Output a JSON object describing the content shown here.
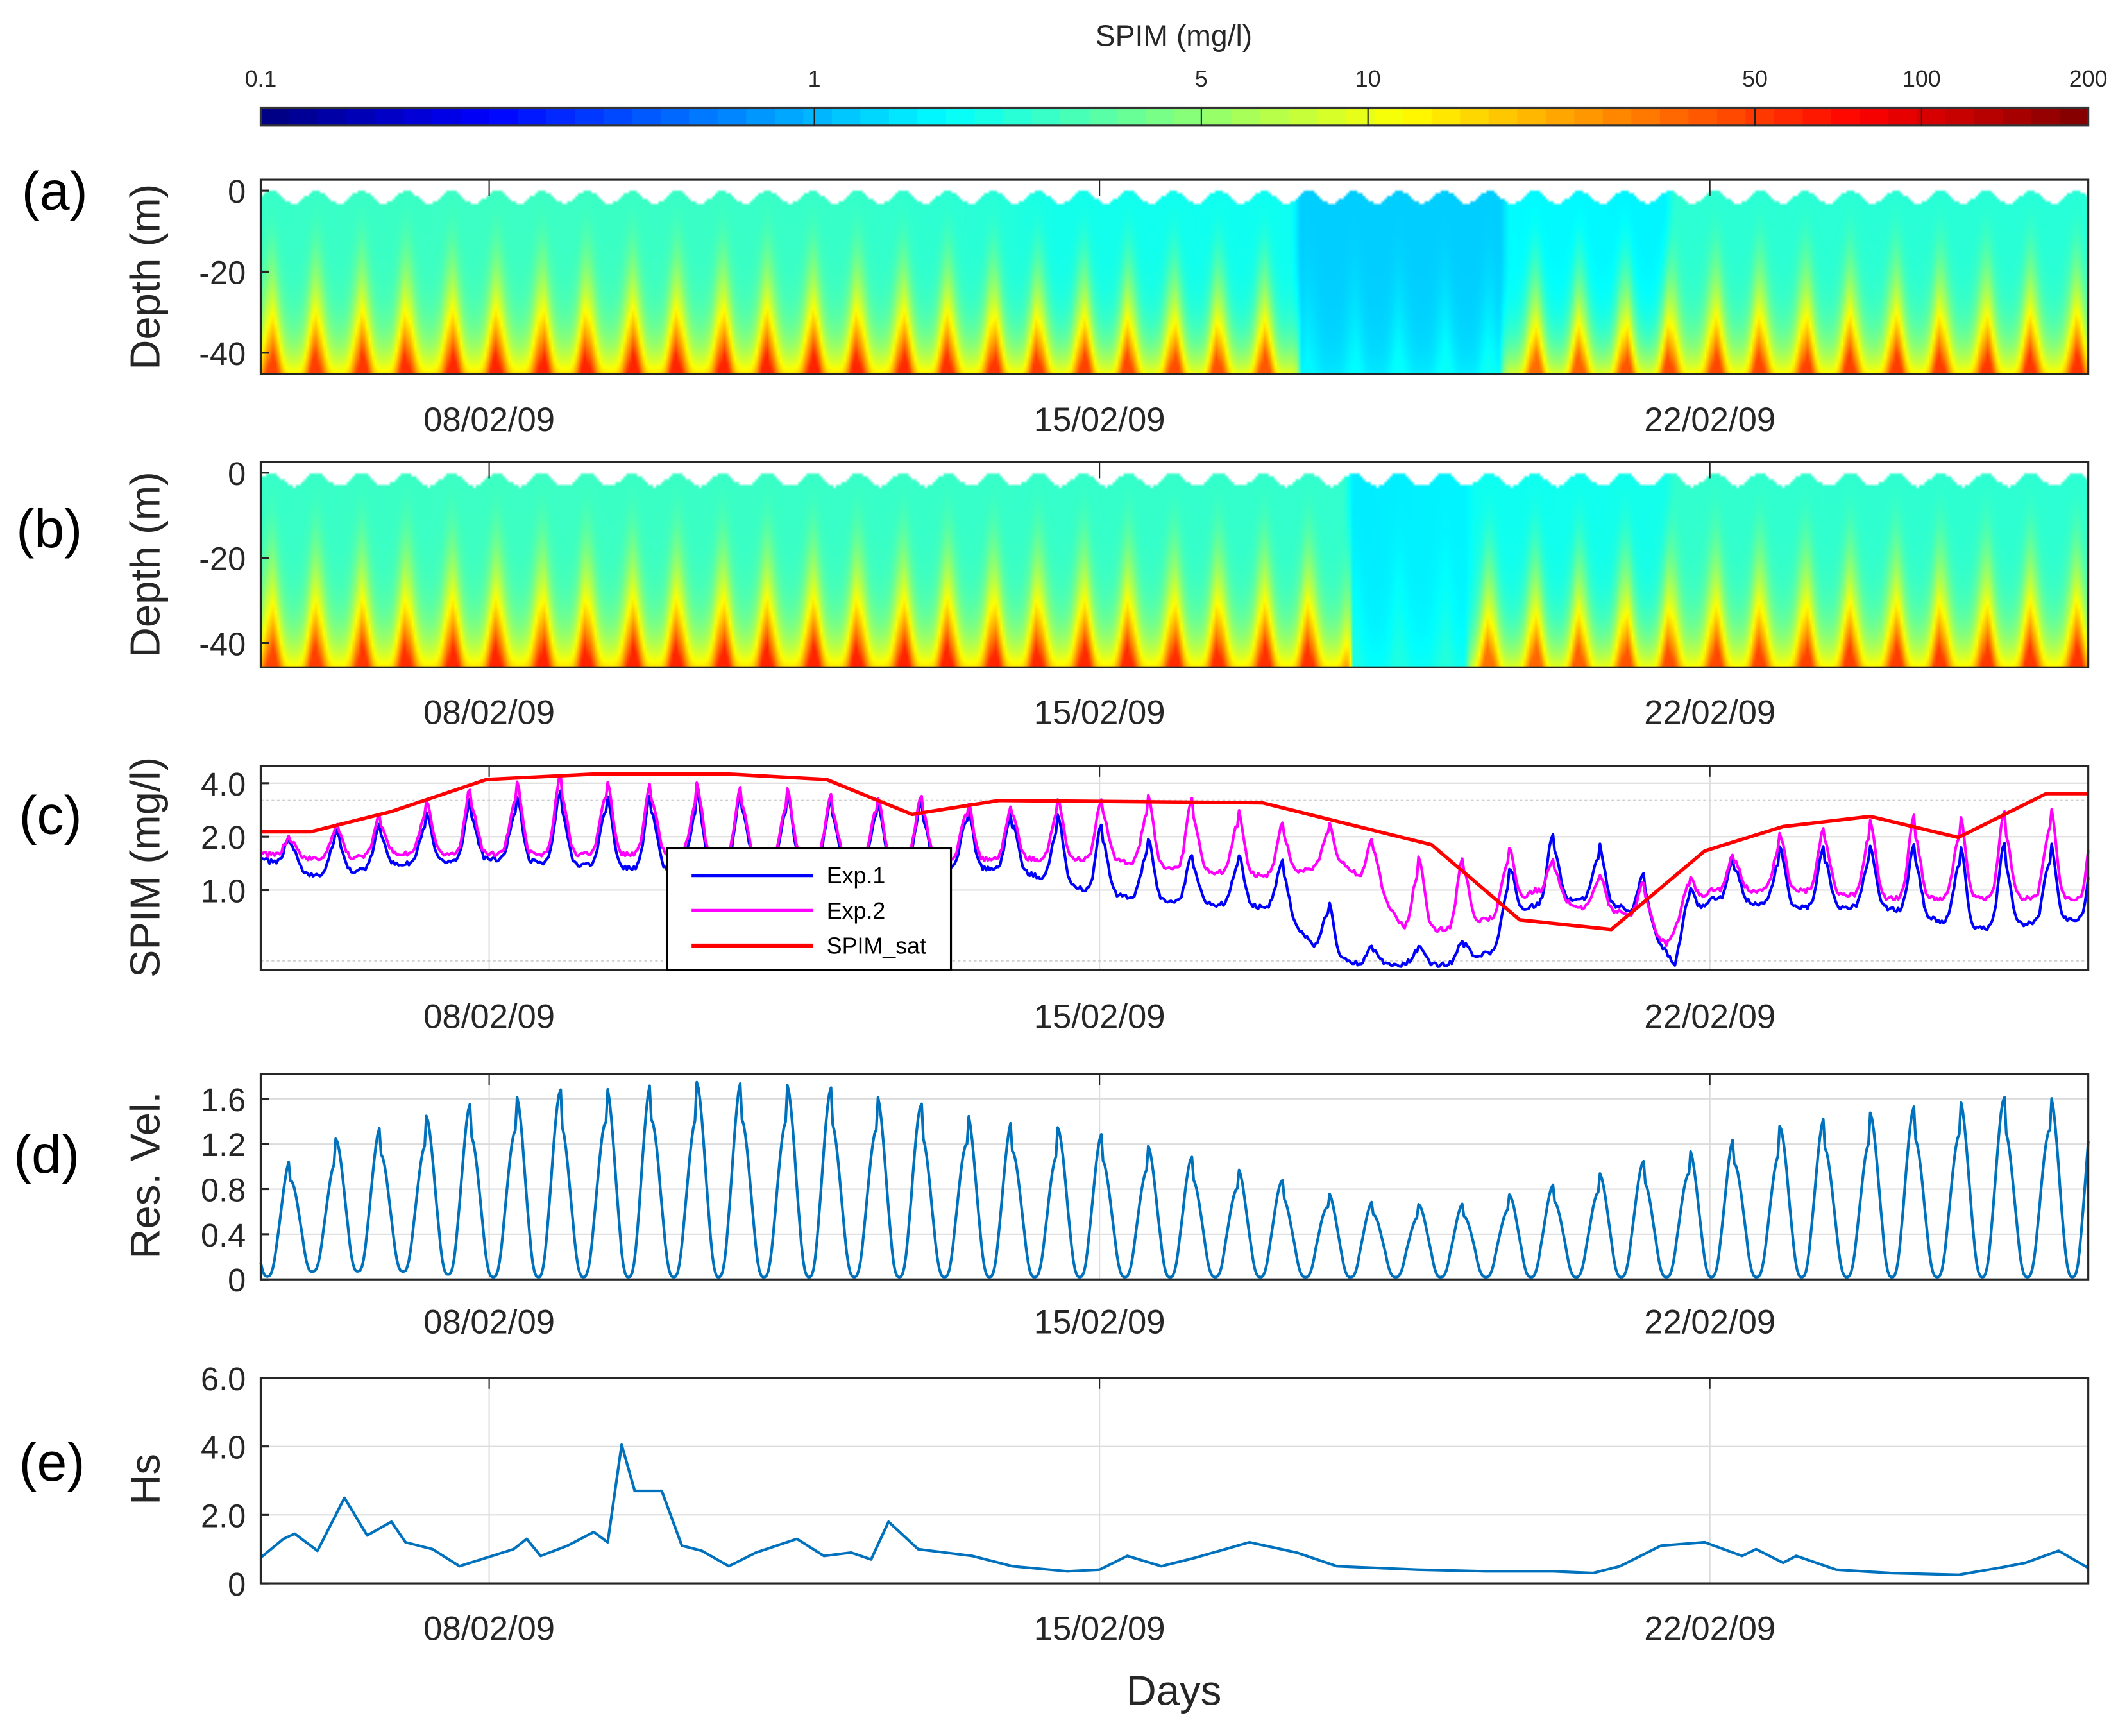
{
  "colorbar": {
    "title": "SPIM (mg/l)",
    "scale": "log",
    "range": [
      0.1,
      200
    ],
    "colormap": "jet",
    "ticks": [
      0.1,
      1,
      5,
      10,
      50,
      100,
      200
    ],
    "tick_labels": [
      "0.1",
      "1",
      "5",
      "10",
      "50",
      "100",
      "200"
    ]
  },
  "x_axis": {
    "unit": "day of February 2009",
    "range": [
      5.38,
      26.34
    ],
    "ticks": [
      8,
      15,
      22
    ],
    "tick_labels": [
      "08/02/09",
      "15/02/09",
      "22/02/09"
    ],
    "xlabel": "Days"
  },
  "chart_data": [
    {
      "panel": "(a)",
      "type": "heatmap",
      "ylabel": "Depth (m)",
      "ylim": [
        -45.3,
        2.7
      ],
      "yticks": [
        0,
        -20,
        -40
      ],
      "ytick_labels": [
        "0",
        "-20",
        "-40"
      ],
      "tidal_period_days": 0.5175,
      "surface_spim": [
        [
          5.38,
          2.6
        ],
        [
          8,
          2.7
        ],
        [
          12,
          2.6
        ],
        [
          13.8,
          2.3
        ],
        [
          14.5,
          2.0
        ],
        [
          17.2,
          1.9
        ],
        [
          17.3,
          1.2
        ],
        [
          19.6,
          1.2
        ],
        [
          19.7,
          1.7
        ],
        [
          21.5,
          1.6
        ],
        [
          21.6,
          2.4
        ],
        [
          26.34,
          2.3
        ]
      ],
      "bottom_spim": [
        [
          5.38,
          35
        ],
        [
          8,
          45
        ],
        [
          12,
          45
        ],
        [
          15,
          35
        ],
        [
          17.2,
          30
        ],
        [
          17.3,
          1.6
        ],
        [
          19.6,
          1.8
        ],
        [
          19.7,
          25
        ],
        [
          22,
          35
        ],
        [
          26.34,
          40
        ]
      ]
    },
    {
      "panel": "(b)",
      "type": "heatmap",
      "ylabel": "Depth (m)",
      "ylim": [
        -45.7,
        2.5
      ],
      "yticks": [
        0,
        -20,
        -40
      ],
      "ytick_labels": [
        "0",
        "-20",
        "-40"
      ],
      "tidal_period_days": 0.5175,
      "surface_spim": [
        [
          5.38,
          2.6
        ],
        [
          8,
          2.7
        ],
        [
          17.8,
          2.5
        ],
        [
          17.9,
          1.5
        ],
        [
          19.2,
          1.6
        ],
        [
          19.3,
          1.9
        ],
        [
          21.5,
          2.0
        ],
        [
          21.6,
          2.5
        ],
        [
          26.34,
          2.4
        ]
      ],
      "bottom_spim": [
        [
          5.38,
          35
        ],
        [
          8,
          45
        ],
        [
          13,
          45
        ],
        [
          17.8,
          40
        ],
        [
          17.9,
          2.0
        ],
        [
          19.2,
          2.2
        ],
        [
          19.3,
          25
        ],
        [
          22,
          35
        ],
        [
          26.34,
          40
        ]
      ]
    },
    {
      "panel": "(c)",
      "type": "line",
      "ylabel": "SPIM (mg/l)",
      "yscale": "log",
      "ylim": [
        0.355,
        5.0
      ],
      "yticks": [
        4.0,
        2.0,
        1.0
      ],
      "ytick_labels": [
        "4.0",
        "2.0",
        "1.0"
      ],
      "minor_grid": [
        0.4,
        3.2,
        5.0
      ],
      "legend": {
        "placement": "lower-center-left",
        "entries": [
          "Exp.1",
          "Exp.2",
          "SPIM_sat"
        ]
      },
      "series": [
        {
          "name": "Exp.1",
          "color": "#0000ff",
          "kind": "tidal_envelope",
          "tidal_period_days": 0.5175,
          "trough_peak": [
            [
              5.38,
              1.5,
              1.9
            ],
            [
              6,
              1.2,
              2.1
            ],
            [
              7,
              1.4,
              2.4
            ],
            [
              8,
              1.5,
              3.4
            ],
            [
              9,
              1.4,
              3.6
            ],
            [
              10,
              1.3,
              3.5
            ],
            [
              11,
              1.4,
              3.6
            ],
            [
              12,
              1.4,
              3.3
            ],
            [
              13,
              1.4,
              3.1
            ],
            [
              14,
              1.3,
              2.8
            ],
            [
              15,
              0.95,
              2.4
            ],
            [
              16,
              0.85,
              1.6
            ],
            [
              17,
              0.8,
              1.6
            ],
            [
              17.5,
              0.45,
              1.0
            ],
            [
              18,
              0.38,
              0.5
            ],
            [
              19,
              0.38,
              0.48
            ],
            [
              19.5,
              0.45,
              0.6
            ],
            [
              19.9,
              0.8,
              2.1
            ],
            [
              20.5,
              0.9,
              2.1
            ],
            [
              21,
              0.8,
              1.5
            ],
            [
              21.6,
              0.38,
              0.8
            ],
            [
              22,
              0.9,
              1.4
            ],
            [
              23,
              0.8,
              1.8
            ],
            [
              24,
              0.8,
              1.8
            ],
            [
              25,
              0.6,
              1.8
            ],
            [
              26.34,
              0.7,
              1.9
            ]
          ]
        },
        {
          "name": "Exp.2",
          "color": "#ff00ff",
          "kind": "tidal_envelope",
          "tidal_period_days": 0.5175,
          "trough_peak": [
            [
              5.38,
              1.6,
              1.8
            ],
            [
              6,
              1.5,
              2.2
            ],
            [
              7,
              1.6,
              2.8
            ],
            [
              8,
              1.6,
              4.0
            ],
            [
              9,
              1.6,
              4.5
            ],
            [
              10,
              1.6,
              4.0
            ],
            [
              11,
              1.5,
              3.8
            ],
            [
              12,
              1.5,
              3.5
            ],
            [
              13,
              1.5,
              3.4
            ],
            [
              14,
              1.5,
              3.1
            ],
            [
              15,
              1.5,
              3.3
            ],
            [
              16,
              1.3,
              3.4
            ],
            [
              17,
              1.2,
              2.4
            ],
            [
              17.8,
              1.4,
              2.4
            ],
            [
              18.5,
              0.6,
              1.6
            ],
            [
              19,
              0.6,
              1.4
            ],
            [
              19.5,
              0.7,
              1.9
            ],
            [
              20,
              1.0,
              1.6
            ],
            [
              20.5,
              0.8,
              1.3
            ],
            [
              21,
              0.75,
              1.2
            ],
            [
              21.5,
              0.5,
              1.0
            ],
            [
              22,
              1.0,
              1.4
            ],
            [
              23,
              1.0,
              2.2
            ],
            [
              24,
              0.9,
              2.6
            ],
            [
              25,
              0.9,
              2.6
            ],
            [
              26.34,
              0.9,
              3.2
            ]
          ]
        },
        {
          "name": "SPIM_sat",
          "color": "#ff0000",
          "kind": "points",
          "points": [
            [
              5.38,
              2.13
            ],
            [
              5.95,
              2.13
            ],
            [
              6.88,
              2.77
            ],
            [
              7.97,
              4.2
            ],
            [
              9.2,
              4.5
            ],
            [
              10.75,
              4.5
            ],
            [
              11.87,
              4.2
            ],
            [
              12.85,
              2.67
            ],
            [
              13.85,
              3.2
            ],
            [
              16.87,
              3.1
            ],
            [
              18.81,
              1.8
            ],
            [
              19.82,
              0.68
            ],
            [
              20.87,
              0.6
            ],
            [
              21.94,
              1.66
            ],
            [
              22.84,
              2.28
            ],
            [
              23.84,
              2.6
            ],
            [
              24.85,
              1.98
            ],
            [
              25.86,
              3.5
            ],
            [
              26.34,
              3.5
            ]
          ]
        }
      ]
    },
    {
      "panel": "(d)",
      "type": "line",
      "ylabel": "Res. Vel.",
      "ylim": [
        0,
        1.82
      ],
      "yticks": [
        1.6,
        1.2,
        0.8,
        0.4,
        0
      ],
      "ytick_labels": [
        "1.6",
        "1.2",
        "0.8",
        "0.4",
        "0"
      ],
      "series": [
        {
          "name": "Res. Vel.",
          "color": "#0072bd",
          "kind": "tidal_envelope",
          "tidal_period_days": 0.5175,
          "secondary_peak_ratio": 0.8,
          "trough_peak": [
            [
              5.38,
              0.1,
              0.9
            ],
            [
              6,
              0.15,
              1.2
            ],
            [
              7,
              0.15,
              1.4
            ],
            [
              8,
              0.1,
              1.6
            ],
            [
              9,
              0.1,
              1.7
            ],
            [
              10,
              0.1,
              1.75
            ],
            [
              11,
              0.1,
              1.75
            ],
            [
              12,
              0.1,
              1.7
            ],
            [
              13,
              0.1,
              1.55
            ],
            [
              14,
              0.1,
              1.4
            ],
            [
              15,
              0.1,
              1.3
            ],
            [
              16,
              0.1,
              1.1
            ],
            [
              17,
              0.1,
              0.9
            ],
            [
              18,
              0.1,
              0.7
            ],
            [
              19,
              0.1,
              0.65
            ],
            [
              20,
              0.1,
              0.8
            ],
            [
              21,
              0.1,
              1.0
            ],
            [
              22,
              0.1,
              1.2
            ],
            [
              23,
              0.1,
              1.4
            ],
            [
              24,
              0.1,
              1.5
            ],
            [
              25,
              0.1,
              1.6
            ],
            [
              26.34,
              0.1,
              1.65
            ]
          ]
        }
      ]
    },
    {
      "panel": "(e)",
      "type": "line",
      "ylabel": "Hs",
      "ylim": [
        0,
        6
      ],
      "yticks": [
        6,
        4,
        2,
        0
      ],
      "ytick_labels": [
        "6.0",
        "4.0",
        "2.0",
        "0"
      ],
      "series": [
        {
          "name": "Hs",
          "color": "#0072bd",
          "kind": "points",
          "points": [
            [
              5.38,
              0.75
            ],
            [
              5.64,
              1.3
            ],
            [
              5.77,
              1.45
            ],
            [
              6.03,
              0.95
            ],
            [
              6.34,
              2.5
            ],
            [
              6.6,
              1.4
            ],
            [
              6.88,
              1.8
            ],
            [
              7.04,
              1.2
            ],
            [
              7.35,
              1.0
            ],
            [
              7.66,
              0.5
            ],
            [
              7.97,
              0.75
            ],
            [
              8.28,
              1.0
            ],
            [
              8.43,
              1.3
            ],
            [
              8.59,
              0.8
            ],
            [
              8.9,
              1.1
            ],
            [
              9.2,
              1.5
            ],
            [
              9.36,
              1.2
            ],
            [
              9.52,
              4.05
            ],
            [
              9.67,
              2.7
            ],
            [
              9.98,
              2.7
            ],
            [
              10.21,
              1.1
            ],
            [
              10.44,
              0.95
            ],
            [
              10.75,
              0.5
            ],
            [
              11.06,
              0.9
            ],
            [
              11.53,
              1.3
            ],
            [
              11.84,
              0.8
            ],
            [
              12.15,
              0.9
            ],
            [
              12.38,
              0.7
            ],
            [
              12.58,
              1.8
            ],
            [
              12.92,
              1.0
            ],
            [
              13.23,
              0.9
            ],
            [
              13.54,
              0.8
            ],
            [
              14.0,
              0.5
            ],
            [
              14.63,
              0.35
            ],
            [
              15.0,
              0.4
            ],
            [
              15.32,
              0.8
            ],
            [
              15.71,
              0.5
            ],
            [
              16.1,
              0.75
            ],
            [
              16.72,
              1.2
            ],
            [
              17.26,
              0.9
            ],
            [
              17.72,
              0.5
            ],
            [
              18.65,
              0.4
            ],
            [
              19.43,
              0.35
            ],
            [
              20.2,
              0.35
            ],
            [
              20.66,
              0.3
            ],
            [
              20.97,
              0.5
            ],
            [
              21.44,
              1.1
            ],
            [
              21.94,
              1.2
            ],
            [
              22.37,
              0.8
            ],
            [
              22.53,
              1.0
            ],
            [
              22.84,
              0.6
            ],
            [
              22.99,
              0.8
            ],
            [
              23.45,
              0.4
            ],
            [
              24.07,
              0.3
            ],
            [
              24.85,
              0.25
            ],
            [
              25.31,
              0.45
            ],
            [
              25.62,
              0.6
            ],
            [
              26.0,
              0.95
            ],
            [
              26.34,
              0.45
            ]
          ]
        }
      ]
    }
  ]
}
